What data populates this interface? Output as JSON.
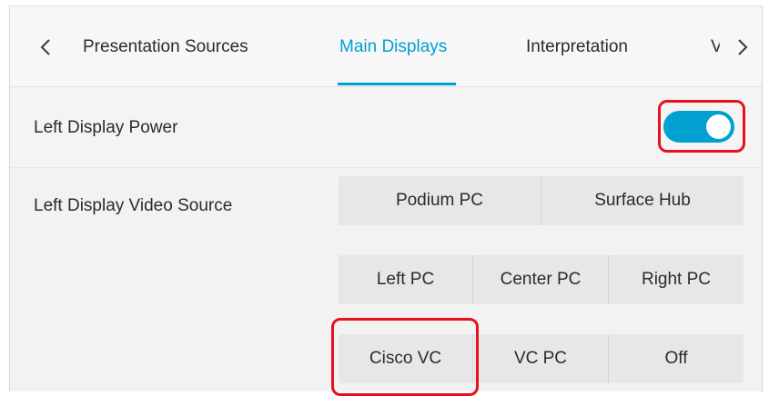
{
  "tabs": {
    "prev_icon": "chevron-left-icon",
    "next_icon": "chevron-right-icon",
    "items": [
      {
        "label": "Presentation Sources",
        "active": false
      },
      {
        "label": "Main Displays",
        "active": true
      },
      {
        "label": "Interpretation",
        "active": false
      },
      {
        "label": "V",
        "active": false
      }
    ],
    "accent_color": "#00a0d1"
  },
  "power_row": {
    "label": "Left Display Power",
    "toggle_on": true
  },
  "video_source": {
    "label": "Left Display Video Source",
    "group1": [
      "Podium PC",
      "Surface Hub"
    ],
    "group2": [
      "Left PC",
      "Center PC",
      "Right PC"
    ],
    "group3": [
      "Cisco VC",
      "VC PC",
      "Off"
    ]
  },
  "highlight_color": "#e8101a"
}
